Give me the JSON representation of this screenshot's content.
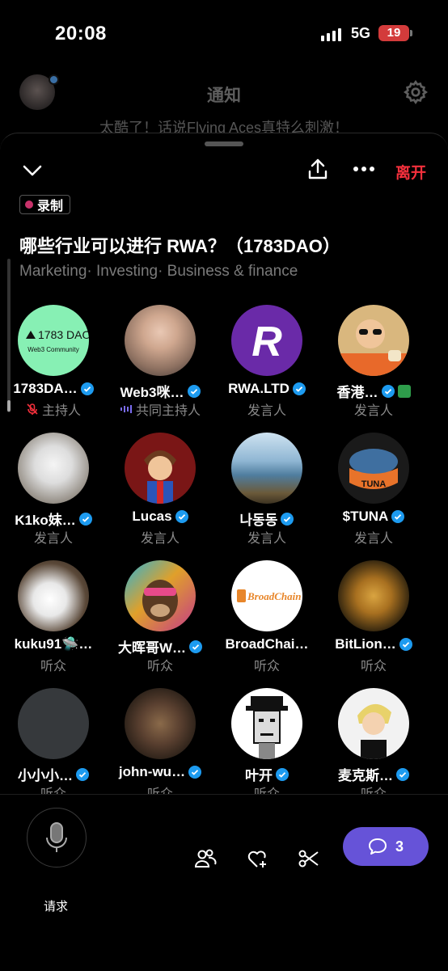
{
  "status": {
    "time": "20:08",
    "network": "5G",
    "battery": "19"
  },
  "background": {
    "title": "通知",
    "subtitle": "太酷了！话说Flying Aces真特么刺激！"
  },
  "space": {
    "leave_label": "离开",
    "recording_label": "录制",
    "title": "哪些行业可以进行 RWA？（1783DAO）",
    "topics": "Marketing· Investing· Business & finance"
  },
  "participants": [
    {
      "name": "1783DA…",
      "role": "主持人",
      "verified": true,
      "avatar_text": "1783 DAO",
      "avatar_sub": "Web3 Community"
    },
    {
      "name": "Web3咪…",
      "role": "共同主持人",
      "verified": true
    },
    {
      "name": "RWA.LTD",
      "role": "发言人",
      "verified": true,
      "avatar_text": "R"
    },
    {
      "name": "香港…",
      "role": "发言人",
      "verified": true
    },
    {
      "name": "K1ko妹…",
      "role": "发言人",
      "verified": true
    },
    {
      "name": "Lucas",
      "role": "发言人",
      "verified": true
    },
    {
      "name": "나동동",
      "role": "发言人",
      "verified": true
    },
    {
      "name": "$TUNA",
      "role": "发言人",
      "verified": true,
      "avatar_text": "TUNA"
    },
    {
      "name": "kuku91🛸…",
      "role": "听众",
      "verified": false
    },
    {
      "name": "大晖哥W…",
      "role": "听众",
      "verified": true
    },
    {
      "name": "BroadChai…",
      "role": "听众",
      "verified": false,
      "avatar_text": "BroadChain"
    },
    {
      "name": "BitLion…",
      "role": "听众",
      "verified": true
    },
    {
      "name": "小小小…",
      "role": "听众",
      "verified": true
    },
    {
      "name": "john-wu…",
      "role": "听众",
      "verified": true
    },
    {
      "name": "叶开",
      "role": "听众",
      "verified": true
    },
    {
      "name": "麦克斯…",
      "role": "听众",
      "verified": true
    }
  ],
  "bottom": {
    "request_label": "请求",
    "chat_count": "3"
  },
  "colors": {
    "accent": "#6653d8",
    "leave": "#f4303c",
    "verified": "#1d9bf0",
    "recording": "#c8326a"
  }
}
